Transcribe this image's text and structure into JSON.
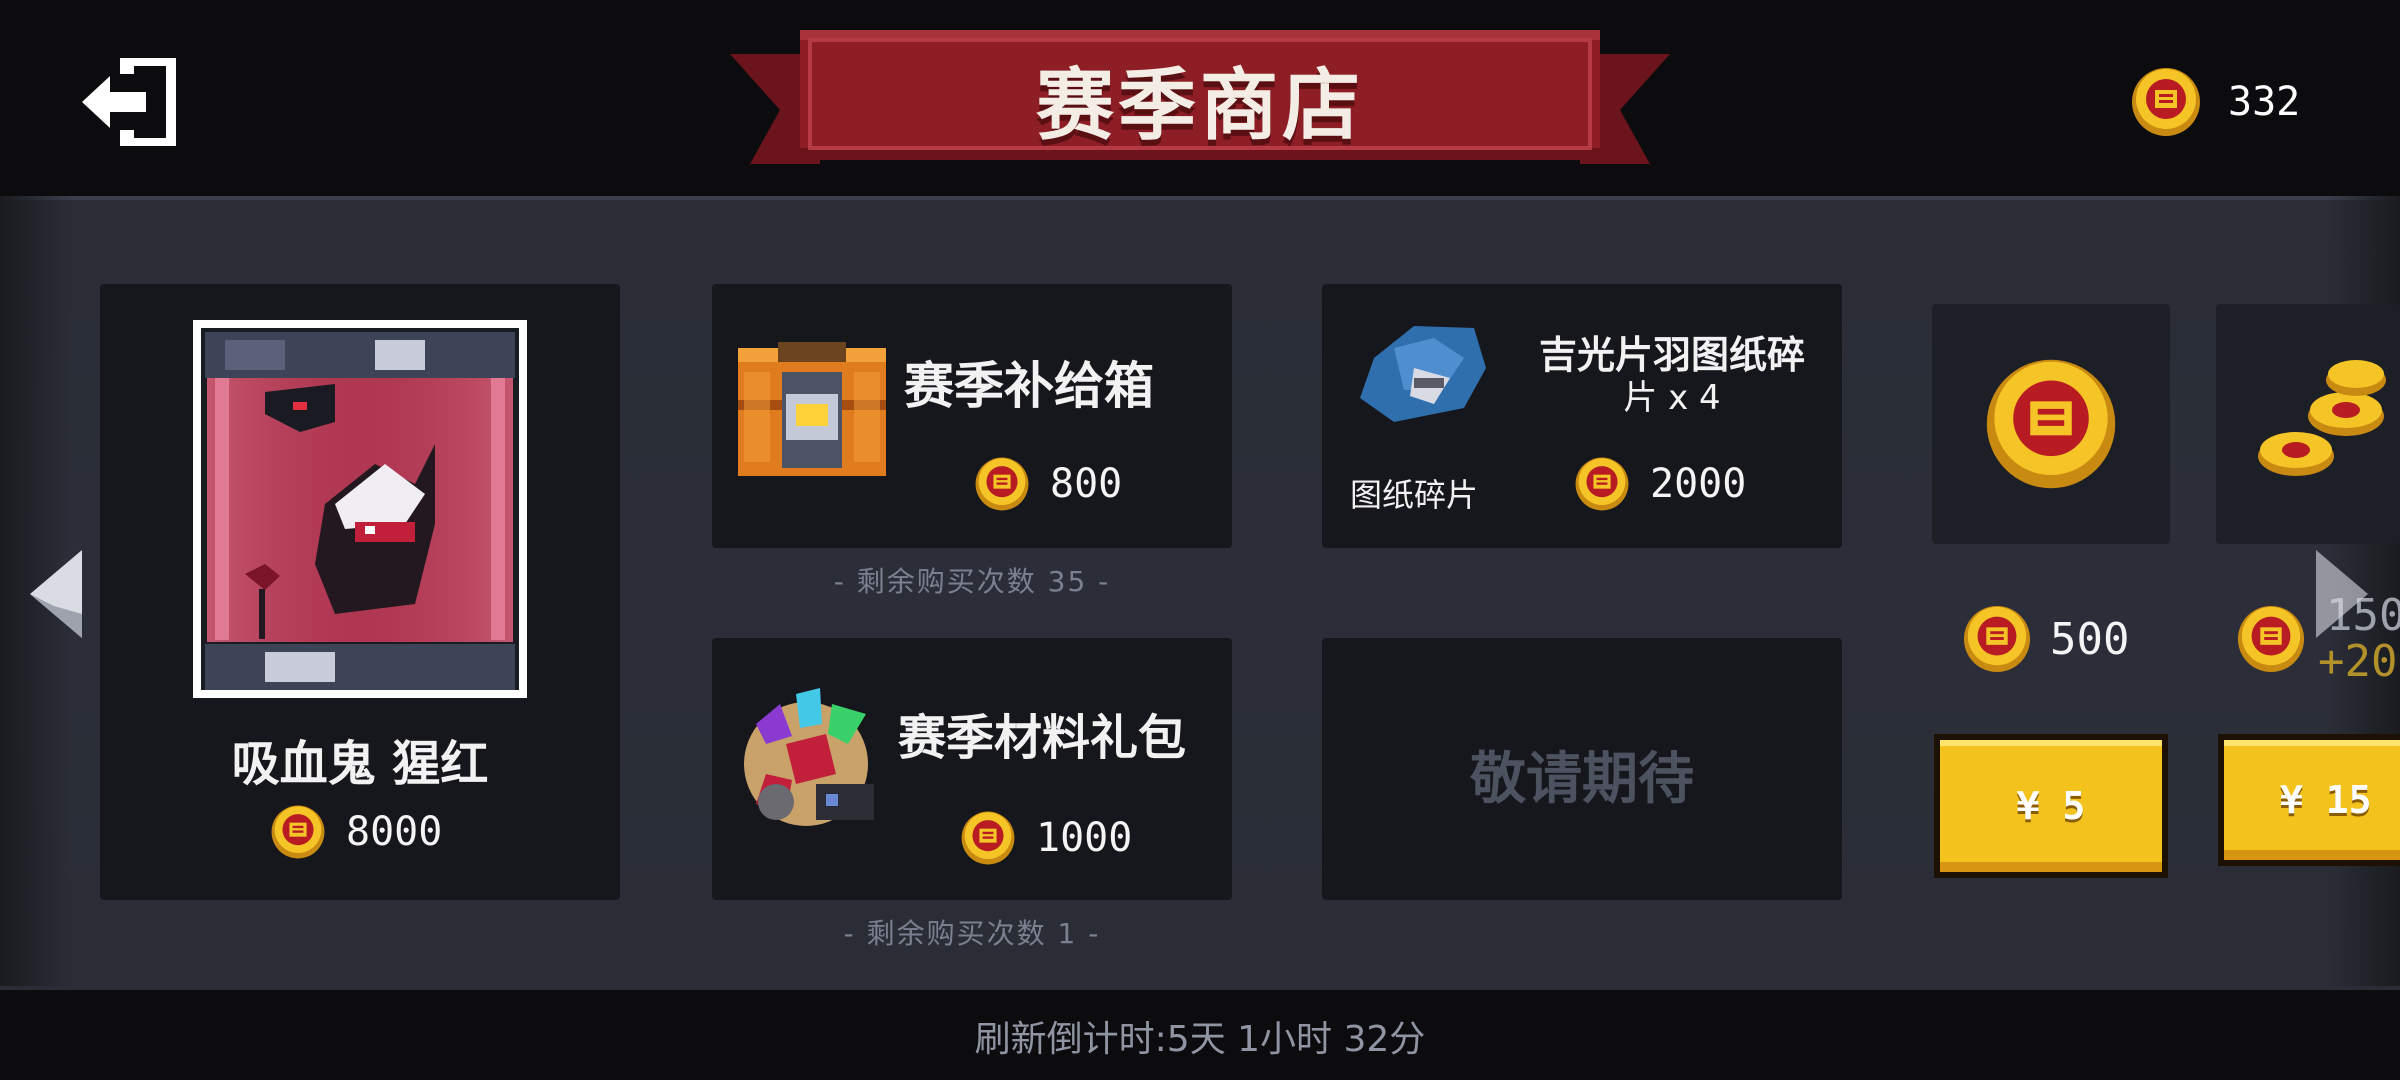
{
  "header": {
    "title": "赛季商店",
    "coin_balance": "332"
  },
  "featured": {
    "name": "吸血鬼 猩红",
    "price": "8000"
  },
  "items": [
    {
      "name": "赛季补给箱",
      "price": "800",
      "remaining": "- 剩余购买次数 35 -"
    },
    {
      "name_line1": "吉光片羽图纸碎",
      "name_line2": "片 x 4",
      "category": "图纸碎片",
      "price": "2000"
    },
    {
      "name": "赛季材料礼包",
      "price": "1000",
      "remaining": "- 剩余购买次数 1 -"
    },
    {
      "name": "敬请期待"
    }
  ],
  "coin_packs": [
    {
      "amount": "500",
      "button": "¥ 5"
    },
    {
      "amount": "150",
      "bonus": "+20",
      "button": "¥ 15"
    }
  ],
  "footer": {
    "refresh_text": "刷新倒计时:5天 1小时 32分"
  },
  "colors": {
    "banner_red": "#8e1e26",
    "coin_gold": "#f4c21c",
    "button_yellow": "#f4c21c",
    "panel": "#2a2d36",
    "card": "#15171c"
  },
  "icons": [
    "exit-icon",
    "coin-icon",
    "left-arrow-icon",
    "right-arrow-icon",
    "chest-icon",
    "crystal-bundle-icon",
    "blueprint-icon",
    "vampire-skin-icon",
    "coin-stack-icon"
  ]
}
